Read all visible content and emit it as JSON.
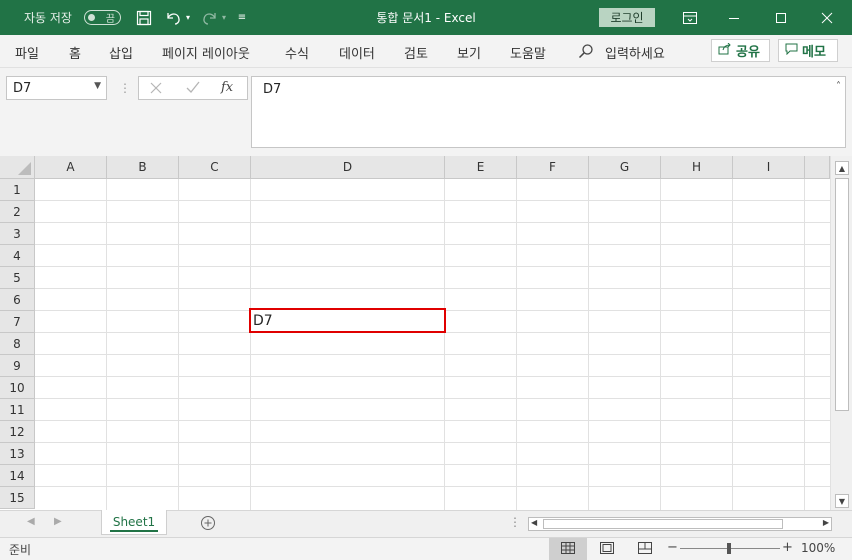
{
  "titlebar": {
    "autosave_label": "자동 저장",
    "autosave_state": "끔",
    "doc_title": "통합 문서1  -  Excel",
    "login_label": "로그인"
  },
  "ribbon": {
    "tabs": [
      "파일",
      "홈",
      "삽입",
      "페이지 레이아웃",
      "수식",
      "데이터",
      "검토",
      "보기",
      "도움말"
    ],
    "tell_me": "입력하세요",
    "share_label": "공유",
    "memo_label": "메모"
  },
  "formula_bar": {
    "name_box": "D7",
    "formula_value": "D7",
    "fx_label": "fx"
  },
  "grid": {
    "columns": [
      "A",
      "B",
      "C",
      "D",
      "E",
      "F",
      "G",
      "H",
      "I"
    ],
    "rows": [
      "1",
      "2",
      "3",
      "4",
      "5",
      "6",
      "7",
      "8",
      "9",
      "10",
      "11",
      "12",
      "13",
      "14",
      "15"
    ],
    "selected_cell": "D7",
    "selected_cell_value": "D7"
  },
  "sheets": {
    "tabs": [
      "Sheet1"
    ]
  },
  "statusbar": {
    "ready": "준비",
    "zoom": "100%"
  },
  "colors": {
    "accent": "#217346",
    "selection": "#e00000"
  }
}
